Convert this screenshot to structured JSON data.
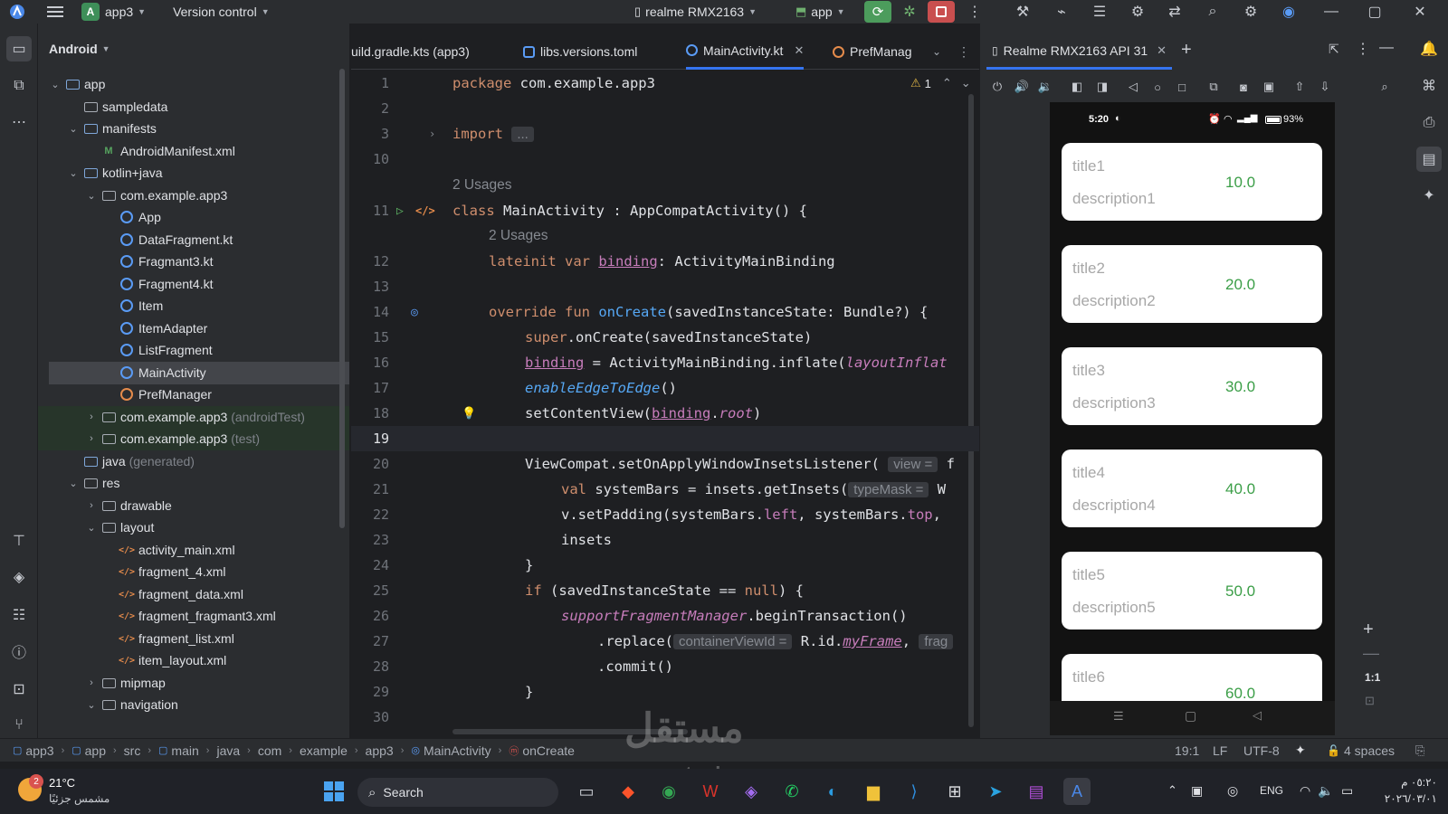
{
  "topbar": {
    "project_badge": "A",
    "project_name": "app3",
    "vcs": "Version control",
    "device": "realme RMX2163",
    "run_config": "app"
  },
  "project_panel": {
    "view": "Android",
    "tree": [
      {
        "label": "app",
        "extra": ""
      },
      {
        "label": "sampledata",
        "extra": ""
      },
      {
        "label": "manifests",
        "extra": ""
      },
      {
        "label": "AndroidManifest.xml",
        "extra": ""
      },
      {
        "label": "kotlin+java",
        "extra": ""
      },
      {
        "label": "com.example.app3",
        "extra": ""
      },
      {
        "label": "App",
        "extra": ""
      },
      {
        "label": "DataFragment.kt",
        "extra": ""
      },
      {
        "label": "Fragmant3.kt",
        "extra": ""
      },
      {
        "label": "Fragment4.kt",
        "extra": ""
      },
      {
        "label": "Item",
        "extra": ""
      },
      {
        "label": "ItemAdapter",
        "extra": ""
      },
      {
        "label": "ListFragment",
        "extra": ""
      },
      {
        "label": "MainActivity",
        "extra": ""
      },
      {
        "label": "PrefManager",
        "extra": ""
      },
      {
        "label": "com.example.app3",
        "extra": "(androidTest)"
      },
      {
        "label": "com.example.app3",
        "extra": "(test)"
      },
      {
        "label": "java",
        "extra": "(generated)"
      },
      {
        "label": "res",
        "extra": ""
      },
      {
        "label": "drawable",
        "extra": ""
      },
      {
        "label": "layout",
        "extra": ""
      },
      {
        "label": "activity_main.xml",
        "extra": ""
      },
      {
        "label": "fragment_4.xml",
        "extra": ""
      },
      {
        "label": "fragment_data.xml",
        "extra": ""
      },
      {
        "label": "fragment_fragmant3.xml",
        "extra": ""
      },
      {
        "label": "fragment_list.xml",
        "extra": ""
      },
      {
        "label": "item_layout.xml",
        "extra": ""
      },
      {
        "label": "mipmap",
        "extra": ""
      },
      {
        "label": "navigation",
        "extra": ""
      }
    ]
  },
  "editor": {
    "tabs": [
      "uild.gradle.kts (app3)",
      "libs.versions.toml",
      "MainActivity.kt",
      "PrefManag"
    ],
    "warning_count": "1",
    "usages_class": "2 Usages",
    "usages_binding": "2 Usages",
    "line_numbers": [
      "1",
      "2",
      "3",
      "10",
      "11",
      "12",
      "13",
      "14",
      "15",
      "16",
      "17",
      "18",
      "19",
      "20",
      "21",
      "22",
      "23",
      "24",
      "25",
      "26",
      "27",
      "28",
      "29",
      "30"
    ],
    "code": {
      "l1_kw": "package",
      "l1_rest": " com.example.app3",
      "l3_kw": "import",
      "l3_fold": "...",
      "l11_kw": "class",
      "l11_rest": " MainActivity : AppCompatActivity() {",
      "l12_kw": "lateinit var",
      "l12_prop": "binding",
      "l12_rest": ": ActivityMainBinding",
      "l14_kw": "override fun",
      "l14_fn": "onCreate",
      "l14_rest": "(savedInstanceState: Bundle?) {",
      "l15_kw": "super",
      "l15_rest": ".onCreate(savedInstanceState)",
      "l16_prop": "binding",
      "l16_rest": " = ActivityMainBinding.inflate(",
      "l16_it": "layoutInflat",
      "l17_it": "enableEdgeToEdge",
      "l17_rest": "()",
      "l18_a": "setContentView(",
      "l18_prop": "binding",
      "l18_dot": ".",
      "l18_root": "root",
      "l18_end": ")",
      "l20_a": "ViewCompat.setOnApplyWindowInsetsListener(",
      "l20_hint": "view =",
      "l20_end": "f",
      "l21_kw": "val",
      "l21_rest": " systemBars = insets.getInsets(",
      "l21_hint": "typeMask =",
      "l21_end": "W",
      "l22_a": "v.setPadding(systemBars.",
      "l22_left": "left",
      "l22_b": ", systemBars.",
      "l22_top": "top",
      "l22_c": ",",
      "l23": "insets",
      "l24": "}",
      "l25_kw": "if",
      "l25_a": " (savedInstanceState == ",
      "l25_null": "null",
      "l25_b": ") {",
      "l26_it": "supportFragmentManager",
      "l26_rest": ".beginTransaction()",
      "l27_a": ".replace(",
      "l27_hint": "containerViewId =",
      "l27_b": "R.id.",
      "l27_frame": "myFrame",
      "l27_c": ",",
      "l27_hint2": "frag",
      "l28": ".commit()",
      "l29": "}"
    }
  },
  "device_panel": {
    "tab": "Realme RMX2163 API 31",
    "zoom": "1:1",
    "phone": {
      "time": "5:20",
      "battery": "93%",
      "cards": [
        {
          "title": "title1",
          "desc": "description1",
          "value": "10.0"
        },
        {
          "title": "title2",
          "desc": "description2",
          "value": "20.0"
        },
        {
          "title": "title3",
          "desc": "description3",
          "value": "30.0"
        },
        {
          "title": "title4",
          "desc": "description4",
          "value": "40.0"
        },
        {
          "title": "title5",
          "desc": "description5",
          "value": "50.0"
        },
        {
          "title": "title6",
          "desc": "",
          "value": "60.0"
        }
      ]
    }
  },
  "statusbar": {
    "crumbs": [
      "app3",
      "app",
      "src",
      "main",
      "java",
      "com",
      "example",
      "app3",
      "MainActivity",
      "onCreate"
    ],
    "position": "19:1",
    "line_sep": "LF",
    "encoding": "UTF-8",
    "indent": "4 spaces"
  },
  "taskbar": {
    "temp": "21°C",
    "weather": "مشمس جزئيًا",
    "badge": "2",
    "search": "Search",
    "lang": "ENG",
    "time": "٠٥:٢٠ م",
    "date": "٢٠٢٦/٠٣/٠١"
  },
  "watermark": "mostaql.com",
  "colors": {
    "accent": "#3574f0",
    "run_green": "#4c9c5c",
    "stop_red": "#c94f4f",
    "value_green": "#3b9e47"
  }
}
